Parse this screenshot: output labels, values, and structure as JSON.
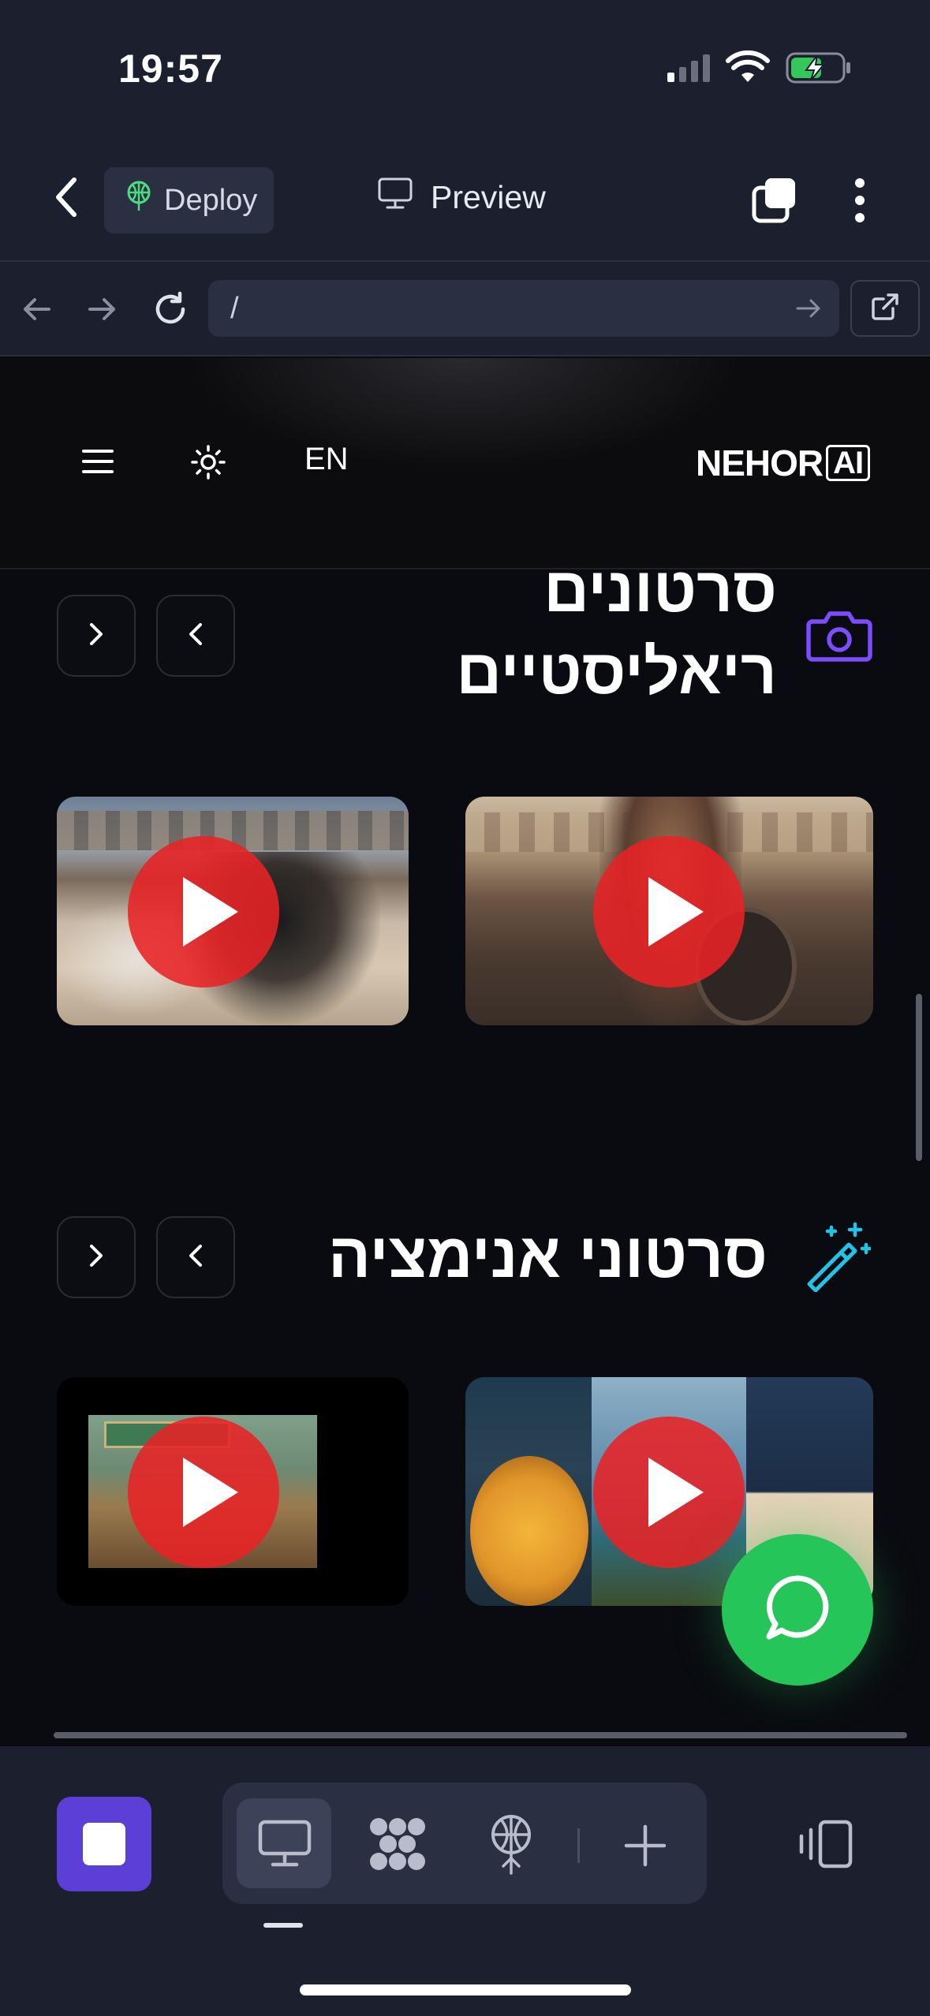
{
  "status_bar": {
    "time": "19:57"
  },
  "app_bar": {
    "deploy_label": "Deploy",
    "preview_label": "Preview"
  },
  "browser": {
    "url": "/"
  },
  "site_header": {
    "logo_text": "NEHOR",
    "logo_ai": "AI",
    "language": "EN"
  },
  "sections": [
    {
      "title_line1": "סרטונים",
      "title_line2": "ריאליסטיים",
      "icon": "camera-icon"
    },
    {
      "title": "סרטוני אנימציה",
      "icon": "magic-wand-icon"
    }
  ],
  "bottom_toolbar": {
    "icons": [
      "desktop-icon",
      "apps-icon",
      "deploy-icon",
      "plus-icon",
      "device-icon"
    ]
  },
  "colors": {
    "accent_purple": "#7c4dff",
    "accent_cyan": "#22c3e6",
    "play_red": "#e82226",
    "whatsapp_green": "#25c55a"
  }
}
